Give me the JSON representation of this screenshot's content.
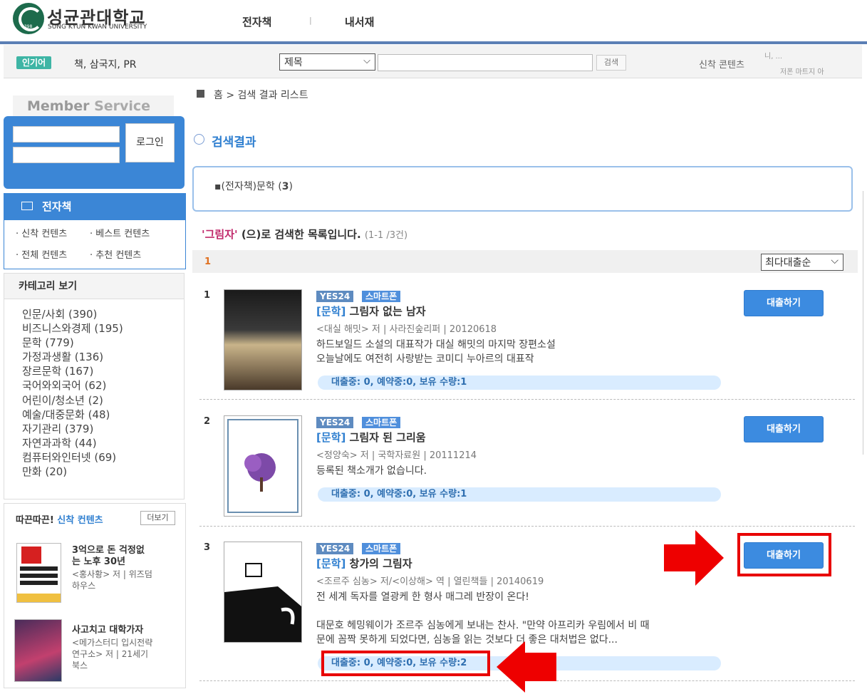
{
  "header": {
    "logo_ko": "성균관대학교",
    "logo_en": "SUNG KYUN KWAN UNIVERSITY",
    "logo_year": "1398",
    "nav": [
      "전자책",
      "내서재"
    ],
    "nav_sep": "|"
  },
  "searchbar": {
    "popular_badge": "인기어",
    "popular_terms": "책, 삼국지, PR",
    "field_select": "제목",
    "search_button": "검색",
    "new_contents": "신착 콘텐츠",
    "ticker_1": "니, ...",
    "ticker_2": "저폰 마트지 아"
  },
  "sidebar": {
    "member_title_1": "Member ",
    "member_title_2": "Service",
    "login_button": "로그인",
    "ebook_header": "전자책",
    "ebook_links": [
      "신착 컨텐츠",
      "베스트 컨텐츠",
      "전체 컨텐츠",
      "추천 컨텐츠"
    ],
    "category_header": "카테고리 보기",
    "categories": [
      "인문/사회 (390)",
      "비즈니스와경제 (195)",
      "문학 (779)",
      "가정과생활 (136)",
      "장르문학 (167)",
      "국어와외국어 (62)",
      "어린이/청소년 (2)",
      "예술/대중문화 (48)",
      "자기관리 (379)",
      "자연과과학 (44)",
      "컴퓨터와인터넷 (69)",
      "만화 (20)"
    ],
    "new_header_1": "따끈따끈! ",
    "new_header_2": "신착 컨텐츠",
    "more_button": "더보기",
    "new_books": [
      {
        "title_1": "3억으로 돈 걱정없",
        "title_2": "는 노후 30년",
        "meta_1": "<홍사황> 저 | 위즈덤",
        "meta_2": "하우스"
      },
      {
        "title_1": "사고치고 대학가자",
        "meta_1": "<메가스터디 입시전략",
        "meta_2": "연구소> 저 | 21세기",
        "meta_3": "북스"
      }
    ]
  },
  "main": {
    "breadcrumb": "홈 > 검색 결과 리스트",
    "section_title": "검색결과",
    "facet_prefix": "▪(전자책)문학 (",
    "facet_count": "3",
    "facet_suffix": ")",
    "query_keyword": "'그림자'",
    "query_text": " (으)로 검색한 목록입니다. ",
    "query_count": "(1-1 /3건)",
    "page": "1",
    "sort": "최다대출순",
    "results": [
      {
        "num": "1",
        "badges": [
          "YES24",
          "스마트폰"
        ],
        "category": "[문학]",
        "title": " 그림자 없는 남자",
        "meta": "<대실 해밋> 저 | 사라진숲리퍼 | 20120618",
        "desc_1": "하드보일드 소설의 대표작가 대실 해밋의 마지막 장편소설",
        "desc_2": "오늘날에도 여전히 사랑받는 코미디 누아르의 대표작",
        "status": "대출중: 0, 예약중:0, 보유 수량:1",
        "button": "대출하기"
      },
      {
        "num": "2",
        "badges": [
          "YES24",
          "스마트폰"
        ],
        "category": "[문학]",
        "title": " 그림자 된 그리움",
        "meta": "<정양숙> 저 | 국학자료원 | 20111214",
        "desc_1": "등록된 책소개가 없습니다.",
        "status": "대출중: 0, 예약중:0, 보유 수량:1",
        "button": "대출하기"
      },
      {
        "num": "3",
        "badges": [
          "YES24",
          "스마트폰"
        ],
        "category": "[문학]",
        "title": " 창가의 그림자",
        "meta": "<조르주 심농> 저/<이상해> 역 | 열린책들 | 20140619",
        "desc_1": "전 세계 독자를 열광케 한 형사 매그레 반장이 온다!",
        "desc_2": "대문호 헤밍웨이가 조르주 심농에게 보내는 찬사. \"만약 아프리카 우림에서 비 때",
        "desc_3": "문에 꼼짝 못하게 되었다면, 심농을 읽는 것보다 더 좋은 대처법은 없다...",
        "status": "대출중: 0, 예약중:0, 보유 수량:2",
        "button": "대출하기"
      }
    ]
  },
  "colors": {
    "accent_blue": "#3b86d6",
    "highlight_red": "#e80000",
    "keyword_pink": "#c0286a"
  }
}
